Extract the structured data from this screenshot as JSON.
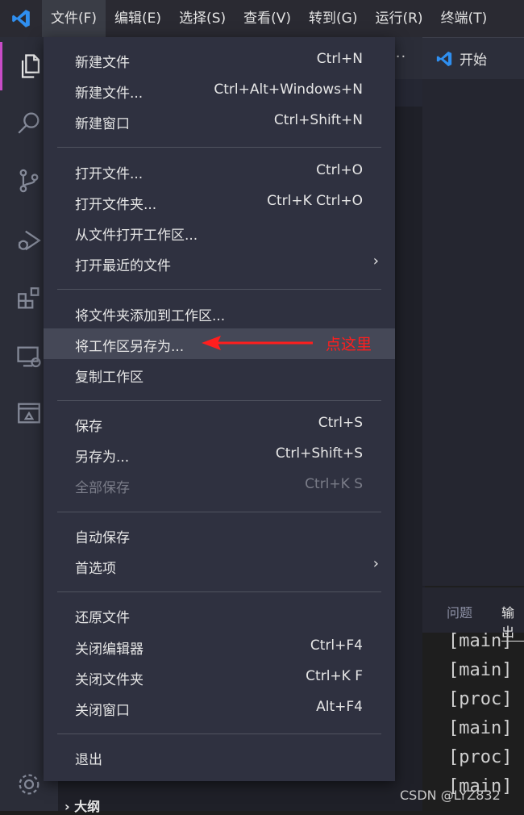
{
  "menubar": {
    "items": [
      "文件(F)",
      "编辑(E)",
      "选择(S)",
      "查看(V)",
      "转到(G)",
      "运行(R)",
      "终端(T)"
    ]
  },
  "editor": {
    "tab_title": "开始"
  },
  "sidebar": {
    "outline_title": "大纲",
    "more": "···"
  },
  "panel": {
    "tabs": [
      "问题",
      "输出"
    ],
    "lines": [
      "[main]",
      "[main]",
      "[proc]",
      "[main]",
      "[proc]",
      "[main]"
    ]
  },
  "file_menu": {
    "groups": [
      [
        {
          "label": "新建文件",
          "shortcut": "Ctrl+N"
        },
        {
          "label": "新建文件...",
          "shortcut": "Ctrl+Alt+Windows+N"
        },
        {
          "label": "新建窗口",
          "shortcut": "Ctrl+Shift+N"
        }
      ],
      [
        {
          "label": "打开文件...",
          "shortcut": "Ctrl+O"
        },
        {
          "label": "打开文件夹...",
          "shortcut": "Ctrl+K Ctrl+O"
        },
        {
          "label": "从文件打开工作区...",
          "shortcut": ""
        },
        {
          "label": "打开最近的文件",
          "shortcut": "",
          "submenu": "›"
        }
      ],
      [
        {
          "label": "将文件夹添加到工作区...",
          "shortcut": ""
        },
        {
          "label": "将工作区另存为...",
          "shortcut": ""
        },
        {
          "label": "复制工作区",
          "shortcut": ""
        }
      ],
      [
        {
          "label": "保存",
          "shortcut": "Ctrl+S"
        },
        {
          "label": "另存为...",
          "shortcut": "Ctrl+Shift+S"
        },
        {
          "label": "全部保存",
          "shortcut": "Ctrl+K S"
        }
      ],
      [
        {
          "label": "自动保存",
          "shortcut": ""
        },
        {
          "label": "首选项",
          "shortcut": "",
          "submenu": "›"
        }
      ],
      [
        {
          "label": "还原文件",
          "shortcut": ""
        },
        {
          "label": "关闭编辑器",
          "shortcut": "Ctrl+F4"
        },
        {
          "label": "关闭文件夹",
          "shortcut": "Ctrl+K F"
        },
        {
          "label": "关闭窗口",
          "shortcut": "Alt+F4"
        }
      ],
      [
        {
          "label": "退出",
          "shortcut": ""
        }
      ]
    ]
  },
  "annotation": {
    "text": "点这里",
    "color": "#ff1e1e"
  },
  "watermark": "CSDN @LYZ832",
  "colors": {
    "accent": "#c84cc7",
    "vscode_blue": "#3b8eea",
    "menu_bg": "#2f3140"
  }
}
